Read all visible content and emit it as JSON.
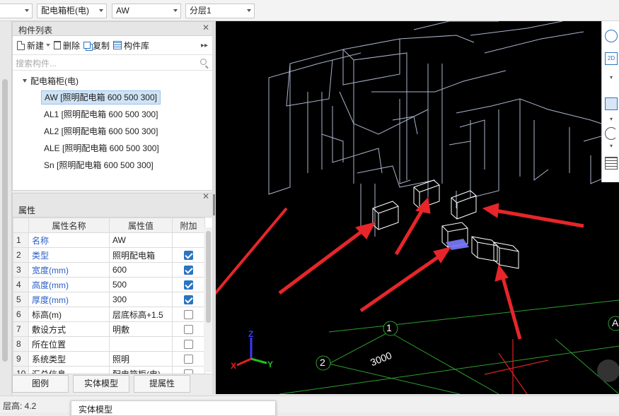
{
  "toolbar": {
    "combo_first": "",
    "combo_category": "配电箱柜(电)",
    "combo_component": "AW",
    "combo_layer": "分层1"
  },
  "component_list": {
    "title": "构件列表",
    "new_label": "新建",
    "delete_label": "删除",
    "copy_label": "复制",
    "library_label": "构件库",
    "search_placeholder": "搜索构件...",
    "tree_root": "配电箱柜(电)",
    "items": [
      {
        "label": "AW [照明配电箱 600 500 300]"
      },
      {
        "label": "AL1 [照明配电箱 600 500 300]"
      },
      {
        "label": "AL2 [照明配电箱 600 500 300]"
      },
      {
        "label": "ALE [照明配电箱 600 500 300]"
      },
      {
        "label": "Sn [照明配电箱 600 500 300]"
      }
    ]
  },
  "properties": {
    "title": "属性",
    "col_name": "属性名称",
    "col_value": "属性值",
    "col_extra": "附加",
    "rows": [
      {
        "no": "1",
        "name": "名称",
        "value": "AW"
      },
      {
        "no": "2",
        "name": "类型",
        "value": "照明配电箱"
      },
      {
        "no": "3",
        "name": "宽度(mm)",
        "value": "600"
      },
      {
        "no": "4",
        "name": "高度(mm)",
        "value": "500"
      },
      {
        "no": "5",
        "name": "厚度(mm)",
        "value": "300"
      },
      {
        "no": "6",
        "name": "标高(m)",
        "value": "层底标高+1.5"
      },
      {
        "no": "7",
        "name": "敷设方式",
        "value": "明敷"
      },
      {
        "no": "8",
        "name": "所在位置",
        "value": ""
      },
      {
        "no": "9",
        "name": "系统类型",
        "value": "照明"
      },
      {
        "no": "10",
        "name": "汇总信息",
        "value": "配电箱柜(电)"
      }
    ]
  },
  "bottom_buttons": {
    "legend": "图例",
    "solid_model": "实体模型",
    "extract_attr": "提属性"
  },
  "status": {
    "floor_height": "层高: 4.2",
    "tooltip": "实体模型"
  },
  "viewport": {
    "axis_x": "X",
    "axis_y": "Y",
    "axis_z": "Z",
    "grid_1": "1",
    "grid_2": "2",
    "grid_a": "A",
    "dimension": "3000"
  }
}
